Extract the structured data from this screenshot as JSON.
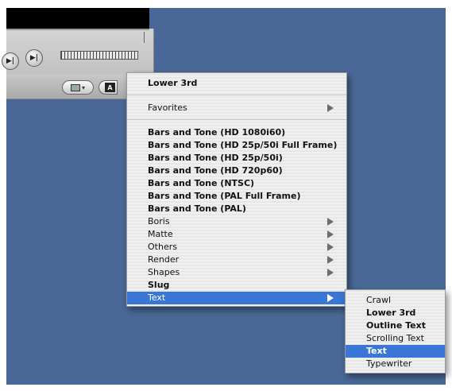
{
  "colors": {
    "desktop": "#4a6897",
    "menu_bg": "#ececec",
    "highlight": "#3976d6",
    "arrow": "#6d6d6d"
  },
  "viewer": {
    "overlay_button_icon": "screen-dropdown-icon",
    "text_button_label": "A"
  },
  "main_menu": {
    "header": "Lower 3rd",
    "favorites": "Favorites",
    "items": [
      {
        "label": "Bars and Tone (HD 1080i60)",
        "bold": true,
        "submenu": false
      },
      {
        "label": "Bars and Tone (HD 25p/50i Full Frame)",
        "bold": true,
        "submenu": false
      },
      {
        "label": "Bars and Tone (HD 25p/50i)",
        "bold": true,
        "submenu": false
      },
      {
        "label": "Bars and Tone (HD 720p60)",
        "bold": true,
        "submenu": false
      },
      {
        "label": "Bars and Tone (NTSC)",
        "bold": true,
        "submenu": false
      },
      {
        "label": "Bars and Tone (PAL Full Frame)",
        "bold": true,
        "submenu": false
      },
      {
        "label": "Bars and Tone (PAL)",
        "bold": true,
        "submenu": false
      },
      {
        "label": "Boris",
        "bold": false,
        "submenu": true
      },
      {
        "label": "Matte",
        "bold": false,
        "submenu": true
      },
      {
        "label": "Others",
        "bold": false,
        "submenu": true
      },
      {
        "label": "Render",
        "bold": false,
        "submenu": true
      },
      {
        "label": "Shapes",
        "bold": false,
        "submenu": true
      },
      {
        "label": "Slug",
        "bold": true,
        "submenu": false
      },
      {
        "label": "Text",
        "bold": false,
        "submenu": true,
        "highlighted": true
      }
    ]
  },
  "sub_menu": {
    "items": [
      {
        "label": "Crawl",
        "bold": false
      },
      {
        "label": "Lower 3rd",
        "bold": true
      },
      {
        "label": "Outline Text",
        "bold": true
      },
      {
        "label": "Scrolling Text",
        "bold": false
      },
      {
        "label": "Text",
        "bold": true,
        "highlighted": true
      },
      {
        "label": "Typewriter",
        "bold": false
      }
    ]
  }
}
